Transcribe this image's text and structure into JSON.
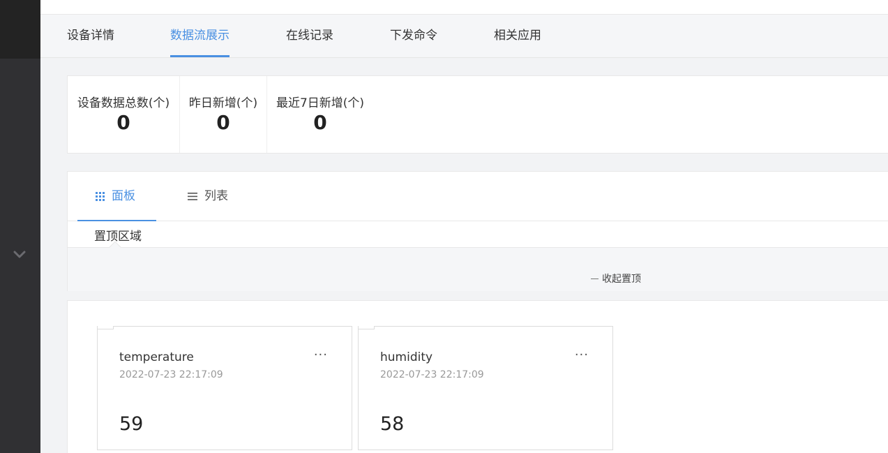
{
  "tabs": [
    {
      "label": "设备详情",
      "active": false
    },
    {
      "label": "数据流展示",
      "active": true
    },
    {
      "label": "在线记录",
      "active": false
    },
    {
      "label": "下发命令",
      "active": false
    },
    {
      "label": "相关应用",
      "active": false
    }
  ],
  "stats": [
    {
      "label": "设备数据总数(个)",
      "value": "0"
    },
    {
      "label": "昨日新增(个)",
      "value": "0"
    },
    {
      "label": "最近7日新增(个)",
      "value": "0"
    }
  ],
  "view_tabs": [
    {
      "label": "面板",
      "icon": "grid-icon",
      "active": true
    },
    {
      "label": "列表",
      "icon": "list-icon",
      "active": false
    }
  ],
  "pinned": {
    "title": "置顶区域",
    "collapse_label": "收起置顶"
  },
  "cards": [
    {
      "name": "temperature",
      "time": "2022-07-23 22:17:09",
      "value": "59",
      "more": "···"
    },
    {
      "name": "humidity",
      "time": "2022-07-23 22:17:09",
      "value": "58",
      "more": "···"
    }
  ],
  "colors": {
    "accent": "#4a90e2",
    "sidebar": "#303033"
  }
}
